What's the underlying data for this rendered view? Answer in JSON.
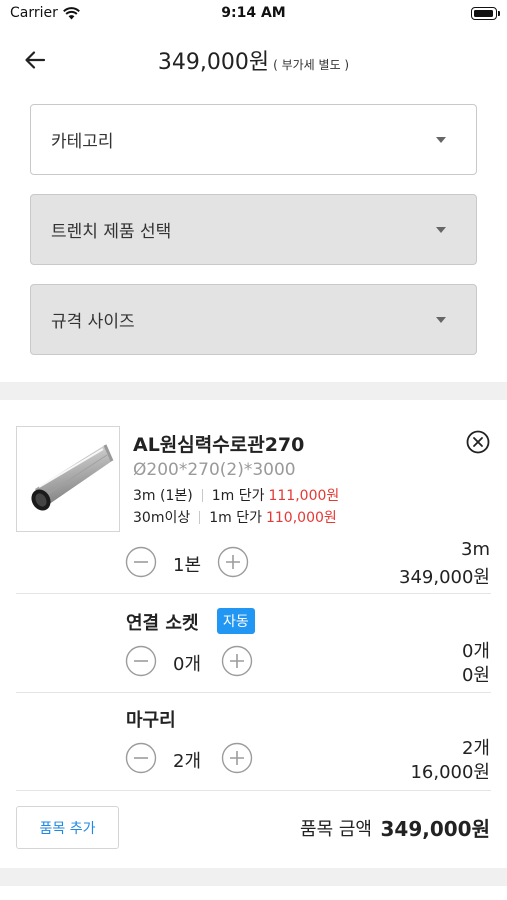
{
  "status_bar": {
    "carrier": "Carrier",
    "time": "9:14 AM"
  },
  "header": {
    "price": "349,000원",
    "vat_note": "( 부가세 별도 )"
  },
  "selects": {
    "category": "카테고리",
    "product": "트렌치 제품 선택",
    "size": "규격 사이즈"
  },
  "product": {
    "name": "AL원심력수로관270",
    "spec": "Ø200*270(2)*3000",
    "price_rows": [
      {
        "condition": "3m (1본)",
        "label": "1m 단가",
        "price": "111,000원"
      },
      {
        "condition": "30m이상",
        "label": "1m 단가",
        "price": "110,000원"
      }
    ],
    "quantity": "1본",
    "length": "3m",
    "subtotal": "349,000원"
  },
  "socket": {
    "title": "연결 소켓",
    "badge": "자동",
    "quantity": "0개",
    "count": "0개",
    "subtotal": "0원"
  },
  "finish": {
    "title": "마구리",
    "quantity": "2개",
    "count": "2개",
    "subtotal": "16,000원"
  },
  "footer": {
    "add_item": "품목 추가",
    "total_label": "품목 금액",
    "total_value": "349,000원"
  },
  "colors": {
    "accent": "#2196f3",
    "price_red": "#e53935",
    "link_blue": "#1e88e5"
  }
}
